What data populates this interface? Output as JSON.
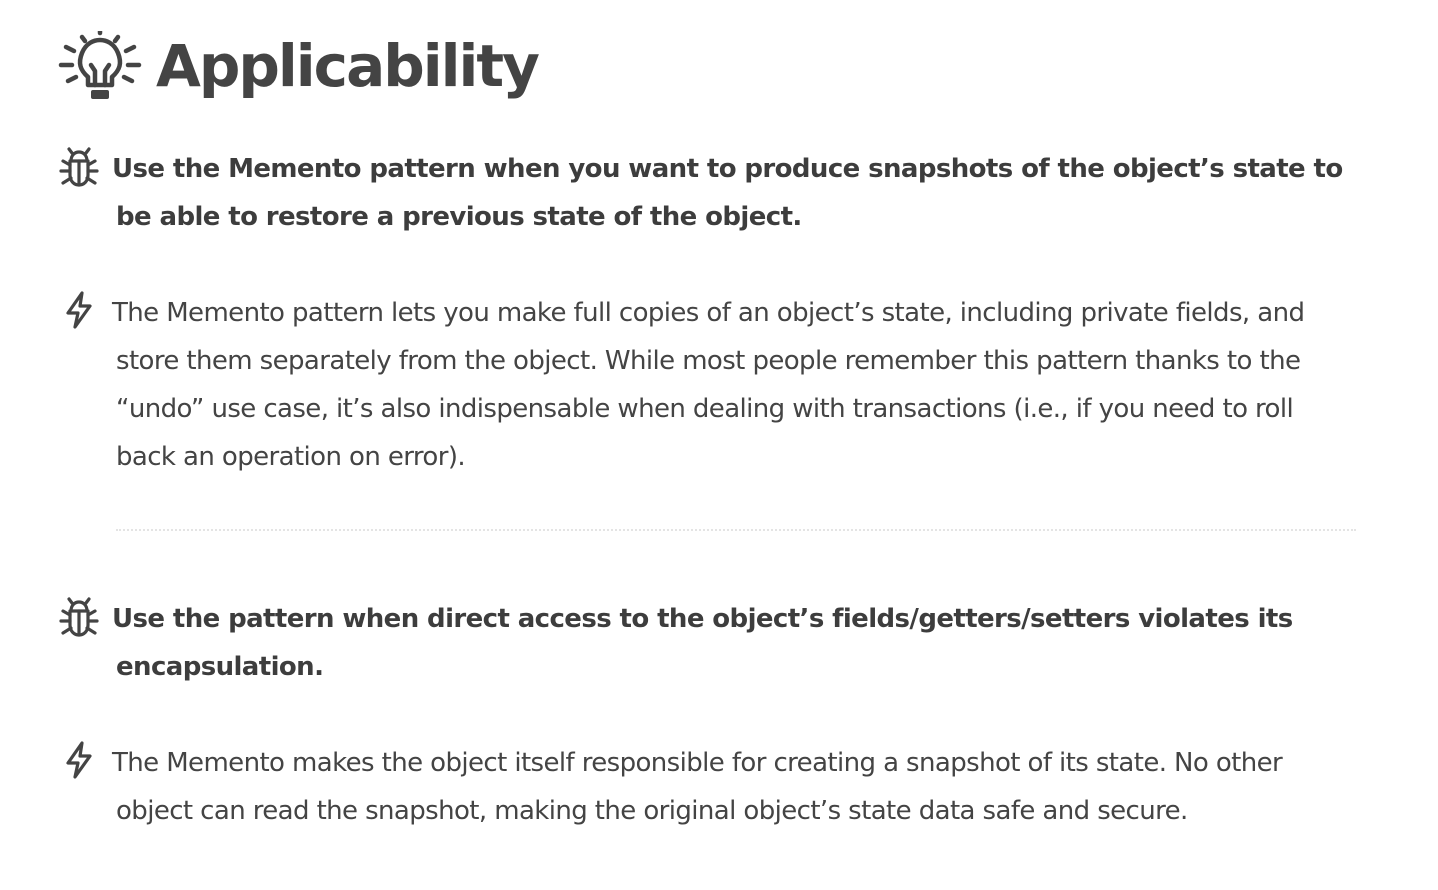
{
  "section": {
    "title": "Applicability",
    "title_icon": "lightbulb-icon"
  },
  "items": [
    {
      "problem_icon": "bug-icon",
      "problem": "Use the Memento pattern when you want to produce snapshots of the object’s state to be able to restore a previous state of the object.",
      "solution_icon": "lightning-icon",
      "solution": "The Memento pattern lets you make full copies of an object’s state, including private fields, and store them separately from the object. While most people remember this pattern thanks to the “undo” use case, it’s also indispensable when dealing with transactions (i.e., if you need to roll back an operation on error)."
    },
    {
      "problem_icon": "bug-icon",
      "problem": "Use the pattern when direct access to the object’s fields/getters/setters violates its encapsulation.",
      "solution_icon": "lightning-icon",
      "solution": "The Memento makes the object itself responsible for creating a snapshot of its state. No other object can read the snapshot, making the original object’s state data safe and secure."
    }
  ],
  "colors": {
    "text": "#444444",
    "divider": "#e4e4e4",
    "background": "#ffffff"
  }
}
